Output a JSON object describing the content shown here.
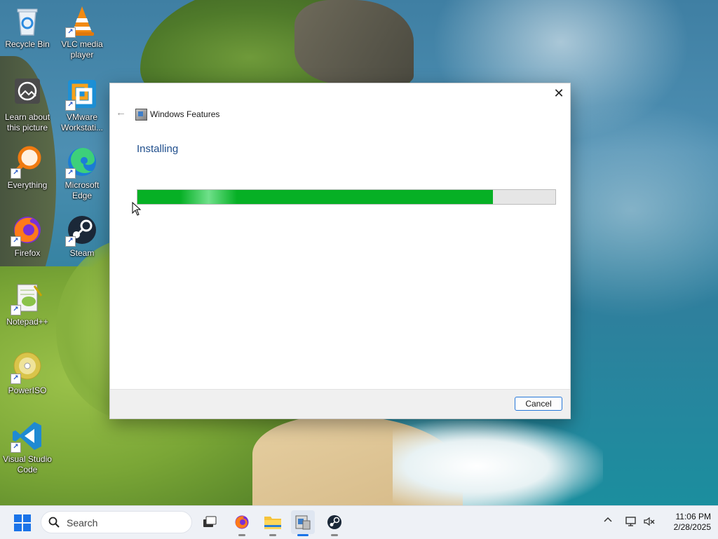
{
  "desktop": {
    "icons": [
      {
        "label": "Recycle Bin",
        "icon": "recycle-bin-icon"
      },
      {
        "label": "VLC media player",
        "icon": "vlc-icon"
      },
      {
        "label": "Learn about this picture",
        "icon": "learn-picture-icon"
      },
      {
        "label": "VMware Workstati...",
        "icon": "vmware-icon"
      },
      {
        "label": "Everything",
        "icon": "everything-icon"
      },
      {
        "label": "Microsoft Edge",
        "icon": "edge-icon"
      },
      {
        "label": "Firefox",
        "icon": "firefox-icon"
      },
      {
        "label": "Steam",
        "icon": "steam-icon"
      },
      {
        "label": "Notepad++",
        "icon": "notepad-plus-plus-icon"
      },
      {
        "label": "PowerISO",
        "icon": "poweriso-icon"
      },
      {
        "label": "Visual Studio Code",
        "icon": "vscode-icon"
      }
    ]
  },
  "dialog": {
    "title": "Windows Features",
    "heading": "Installing",
    "progress_fraction": 0.85,
    "cancel_label": "Cancel",
    "progress_color": "#06b025",
    "heading_color": "#1f4e8c"
  },
  "taskbar": {
    "search_placeholder": "Search",
    "apps": [
      "task-view",
      "firefox",
      "file-explorer",
      "windows-features",
      "steam"
    ],
    "clock": {
      "time": "11:06 PM",
      "date": "2/28/2025"
    }
  }
}
